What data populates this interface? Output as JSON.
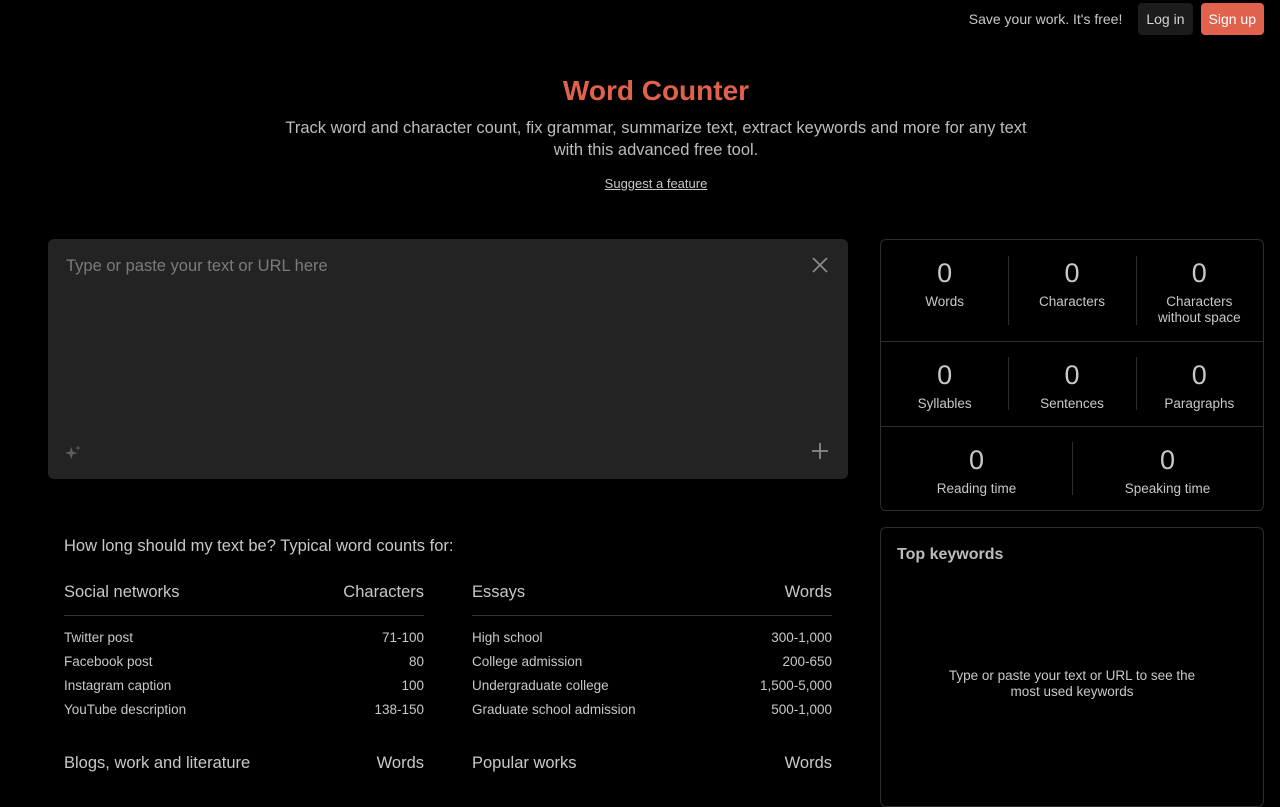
{
  "header": {
    "cta": "Save your work. It's free!",
    "login": "Log in",
    "signup": "Sign up"
  },
  "hero": {
    "title": "Word Counter",
    "subtitle": "Track word and character count, fix grammar, summarize text, extract keywords and more for any text with this advanced free tool.",
    "suggest": "Suggest a feature"
  },
  "editor": {
    "placeholder": "Type or paste your text or URL here"
  },
  "stats": [
    {
      "value": "0",
      "label": "Words"
    },
    {
      "value": "0",
      "label": "Characters"
    },
    {
      "value": "0",
      "label": "Characters without space"
    },
    {
      "value": "0",
      "label": "Syllables"
    },
    {
      "value": "0",
      "label": "Sentences"
    },
    {
      "value": "0",
      "label": "Paragraphs"
    },
    {
      "value": "0",
      "label": "Reading time"
    },
    {
      "value": "0",
      "label": "Speaking time"
    }
  ],
  "keywords": {
    "title": "Top keywords",
    "empty": "Type or paste your text or URL to see the most used keywords"
  },
  "guide": {
    "question": "How long should my text be? Typical word counts for:",
    "tables": [
      {
        "title": "Social networks",
        "unit": "Characters",
        "rows": [
          [
            "Twitter post",
            "71-100"
          ],
          [
            "Facebook post",
            "80"
          ],
          [
            "Instagram caption",
            "100"
          ],
          [
            "YouTube description",
            "138-150"
          ]
        ]
      },
      {
        "title": "Essays",
        "unit": "Words",
        "rows": [
          [
            "High school",
            "300-1,000"
          ],
          [
            "College admission",
            "200-650"
          ],
          [
            "Undergraduate college",
            "1,500-5,000"
          ],
          [
            "Graduate school admission",
            "500-1,000"
          ]
        ]
      },
      {
        "title": "Blogs, work and literature",
        "unit": "Words",
        "rows": []
      },
      {
        "title": "Popular works",
        "unit": "Words",
        "rows": []
      }
    ]
  }
}
